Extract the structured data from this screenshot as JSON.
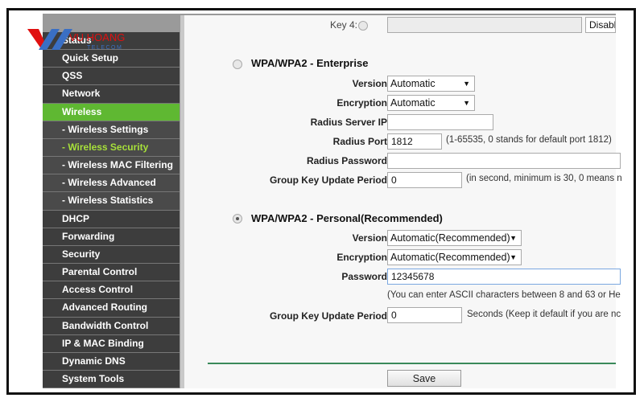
{
  "logo": {
    "text": "VU HOANG",
    "sub": "TELECOM"
  },
  "sidebar": {
    "items": [
      {
        "label": "Status"
      },
      {
        "label": "Quick Setup"
      },
      {
        "label": "QSS"
      },
      {
        "label": "Network"
      },
      {
        "label": "Wireless",
        "active": true
      },
      {
        "label": "- Wireless Settings"
      },
      {
        "label": "- Wireless Security",
        "current": true
      },
      {
        "label": "- Wireless MAC Filtering"
      },
      {
        "label": "- Wireless Advanced"
      },
      {
        "label": "- Wireless Statistics"
      },
      {
        "label": "DHCP"
      },
      {
        "label": "Forwarding"
      },
      {
        "label": "Security"
      },
      {
        "label": "Parental Control"
      },
      {
        "label": "Access Control"
      },
      {
        "label": "Advanced Routing"
      },
      {
        "label": "Bandwidth Control"
      },
      {
        "label": "IP & MAC Binding"
      },
      {
        "label": "Dynamic DNS"
      },
      {
        "label": "System Tools"
      }
    ]
  },
  "wep": {
    "key4_label": "Key 4:",
    "key4_value": "",
    "key4_state": "Disabl"
  },
  "enterprise": {
    "title": "WPA/WPA2 - Enterprise",
    "selected": false,
    "version_label": "Version:",
    "version": "Automatic",
    "encryption_label": "Encryption:",
    "encryption": "Automatic",
    "radius_ip_label": "Radius Server IP:",
    "radius_ip": "",
    "radius_port_label": "Radius Port:",
    "radius_port": "1812",
    "radius_port_note": "(1-65535, 0 stands for default port 1812)",
    "radius_password_label": "Radius Password:",
    "radius_password": "",
    "gkup_label": "Group Key Update Period:",
    "gkup": "0",
    "gkup_note": "(in second, minimum is 30, 0 means n"
  },
  "personal": {
    "title": "WPA/WPA2 - Personal(Recommended)",
    "selected": true,
    "version_label": "Version:",
    "version": "Automatic(Recommended)",
    "encryption_label": "Encryption:",
    "encryption": "Automatic(Recommended)",
    "password_label": "Password:",
    "password": "12345678",
    "password_note": "(You can enter ASCII characters between 8 and 63 or He",
    "gkup_label": "Group Key Update Period:",
    "gkup": "0",
    "gkup_note": "Seconds (Keep it default if you are nc"
  },
  "save_label": "Save",
  "colors": {
    "active": "#5fb832",
    "current": "#a7e03a",
    "menu": "#3d3d3d",
    "divider": "#3a8a5a"
  }
}
